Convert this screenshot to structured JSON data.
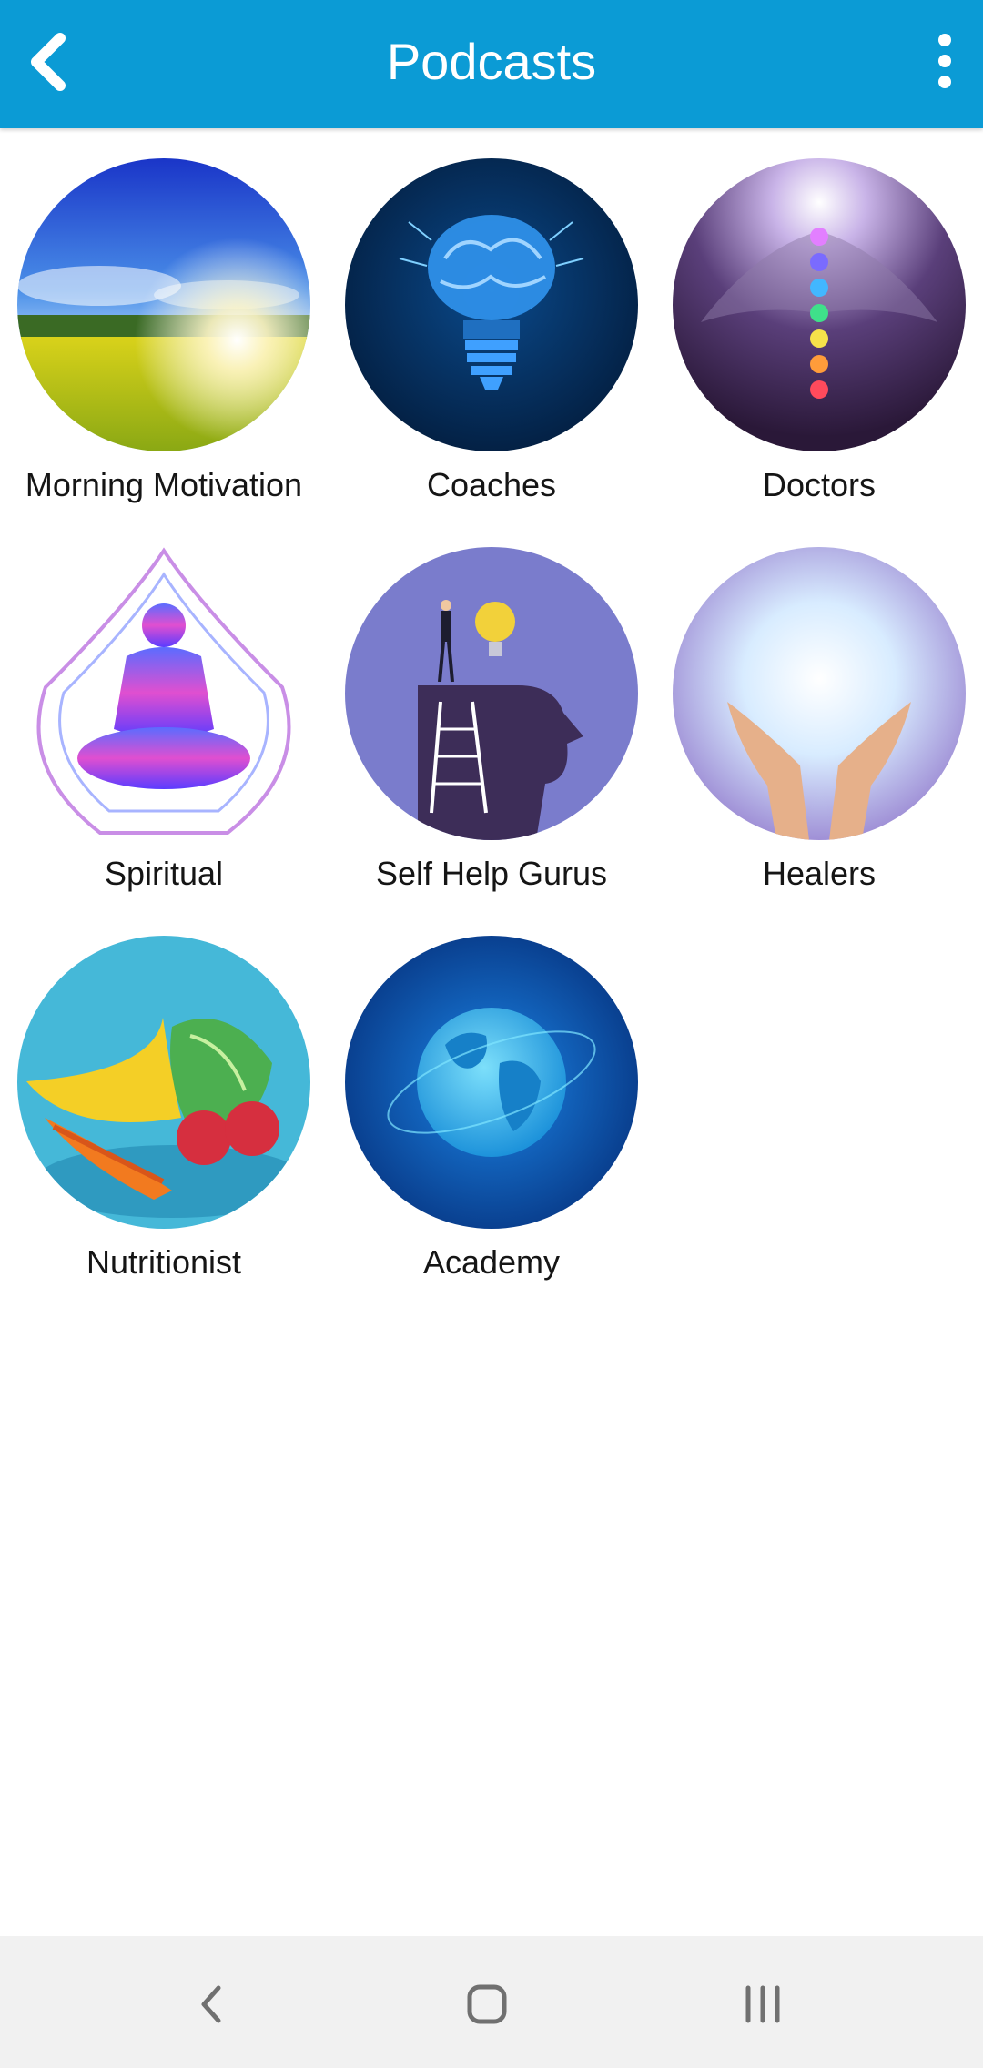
{
  "app_bar": {
    "title": "Podcasts",
    "background": "#0b9bd5",
    "back_icon": "chevron-left-icon",
    "menu_icon": "more-vertical-icon"
  },
  "categories": [
    {
      "label": "Morning Motivation",
      "icon": "sunrise-field-image"
    },
    {
      "label": "Coaches",
      "icon": "brain-lightbulb-image"
    },
    {
      "label": "Doctors",
      "icon": "chakra-angel-image"
    },
    {
      "label": "Spiritual",
      "icon": "meditating-buddha-image"
    },
    {
      "label": "Self Help Gurus",
      "icon": "head-ladder-lightbulb-image"
    },
    {
      "label": "Healers",
      "icon": "healing-hands-image"
    },
    {
      "label": "Nutritionist",
      "icon": "fruits-vegetables-image"
    },
    {
      "label": "Academy",
      "icon": "globe-image"
    }
  ],
  "system_nav": {
    "back_icon": "nav-back-icon",
    "home_icon": "nav-home-icon",
    "recents_icon": "nav-recents-icon"
  }
}
